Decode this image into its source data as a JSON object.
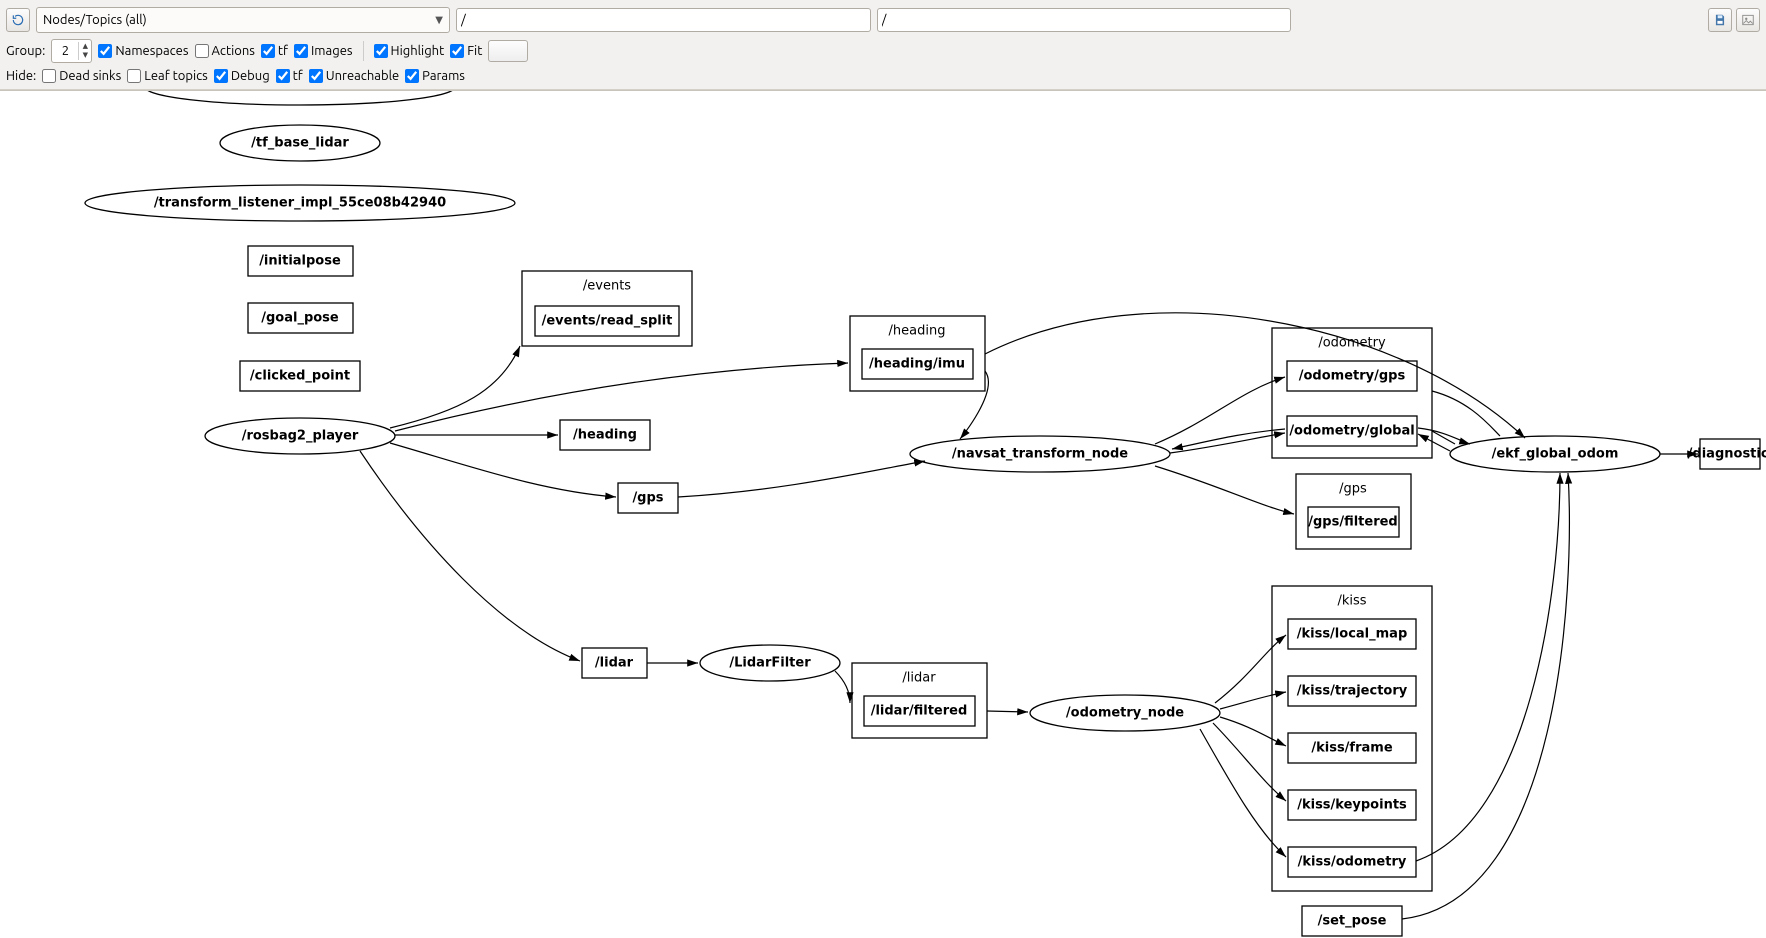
{
  "toolbar": {
    "view_mode": "Nodes/Topics (all)",
    "filter1": "/",
    "filter2": "/",
    "group_label": "Group:",
    "group_value": "2",
    "hide_label": "Hide:",
    "namespaces_label": "Namespaces",
    "namespaces_checked": true,
    "actions_label": "Actions",
    "actions_checked": false,
    "tf1_label": "tf",
    "tf1_checked": true,
    "images_label": "Images",
    "images_checked": true,
    "highlight_label": "Highlight",
    "highlight_checked": true,
    "fit_label": "Fit",
    "fit_checked": true,
    "deadsinks_label": "Dead sinks",
    "deadsinks_checked": false,
    "leaftopics_label": "Leaf topics",
    "leaftopics_checked": false,
    "debug_label": "Debug",
    "debug_checked": true,
    "tf2_label": "tf",
    "tf2_checked": true,
    "unreachable_label": "Unreachable",
    "unreachable_checked": true,
    "params_label": "Params",
    "params_checked": true
  },
  "graph": {
    "ellipse_nodes": {
      "tf_base_lidar": "/tf_base_lidar",
      "transform_listener": "/transform_listener_impl_55ce08b42940",
      "rosbag2_player": "/rosbag2_player",
      "lidar_filter": "/LidarFilter",
      "navsat_transform_node": "/navsat_transform_node",
      "odometry_node": "/odometry_node",
      "ekf_global_odom": "/ekf_global_odom"
    },
    "rect_topics": {
      "initialpose": "/initialpose",
      "goal_pose": "/goal_pose",
      "clicked_point": "/clicked_point",
      "heading_small": "/heading",
      "gps_small": "/gps",
      "lidar_small": "/lidar",
      "set_pose": "/set_pose",
      "diagnostics": "/diagnostics"
    },
    "groups": {
      "events": {
        "title": "/events",
        "items": [
          "/events/read_split"
        ]
      },
      "heading": {
        "title": "/heading",
        "items": [
          "/heading/imu"
        ]
      },
      "lidar": {
        "title": "/lidar",
        "items": [
          "/lidar/filtered"
        ]
      },
      "odometry": {
        "title": "/odometry",
        "items": [
          "/odometry/gps",
          "/odometry/global"
        ]
      },
      "gps": {
        "title": "/gps",
        "items": [
          "/gps/filtered"
        ]
      },
      "kiss": {
        "title": "/kiss",
        "items": [
          "/kiss/local_map",
          "/kiss/trajectory",
          "/kiss/frame",
          "/kiss/keypoints",
          "/kiss/odometry"
        ]
      }
    }
  }
}
